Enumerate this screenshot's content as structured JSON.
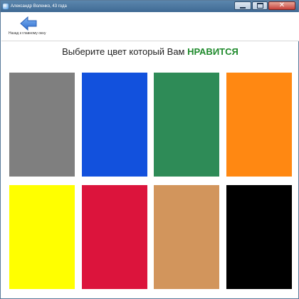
{
  "window": {
    "title": "Александр Воленко, 43 года"
  },
  "toolbar": {
    "back_label": "Назад к главному окну",
    "back_icon": "back-arrow-icon"
  },
  "main": {
    "prompt": "Выберите цвет который Вам",
    "prompt_accent": "НРАВИТСЯ",
    "accent_color": "#1f8a2c",
    "swatches": [
      {
        "color": "#7f7f7f"
      },
      {
        "color": "#1251dd"
      },
      {
        "color": "#2e8b57"
      },
      {
        "color": "#ff8812"
      },
      {
        "color": "#ffff00"
      },
      {
        "color": "#dc143c"
      },
      {
        "color": "#d2955c"
      },
      {
        "color": "#000000"
      }
    ]
  }
}
